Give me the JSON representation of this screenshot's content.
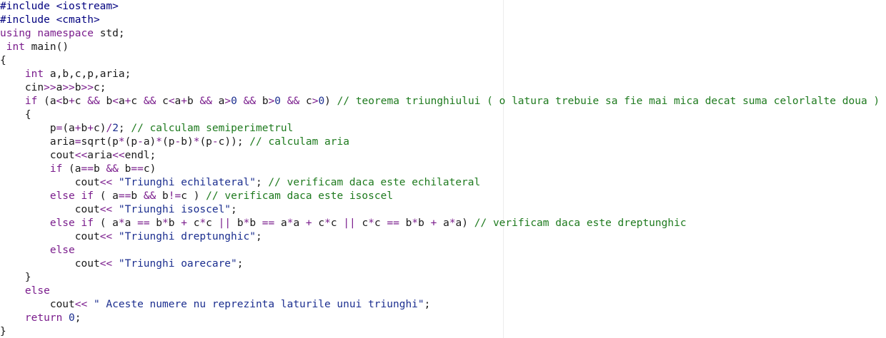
{
  "editor": {
    "lines": [
      {
        "tokens": [
          {
            "t": "#include ",
            "k": "dir"
          },
          {
            "t": "<iostream>",
            "k": "dir"
          }
        ]
      },
      {
        "tokens": [
          {
            "t": "#include ",
            "k": "dir"
          },
          {
            "t": "<cmath>",
            "k": "dir"
          }
        ]
      },
      {
        "tokens": [
          {
            "t": "using",
            "k": "kw"
          },
          {
            "t": " ",
            "k": "text"
          },
          {
            "t": "namespace",
            "k": "kw"
          },
          {
            "t": " std;",
            "k": "text"
          }
        ]
      },
      {
        "tokens": [
          {
            "t": " ",
            "k": "text"
          },
          {
            "t": "int",
            "k": "kw"
          },
          {
            "t": " main()",
            "k": "text"
          }
        ]
      },
      {
        "tokens": [
          {
            "t": "{",
            "k": "text"
          }
        ]
      },
      {
        "tokens": [
          {
            "t": "    ",
            "k": "text"
          },
          {
            "t": "int",
            "k": "kw"
          },
          {
            "t": " a,b,c,p,aria;",
            "k": "text"
          }
        ]
      },
      {
        "tokens": [
          {
            "t": "    cin",
            "k": "text"
          },
          {
            "t": ">>",
            "k": "op"
          },
          {
            "t": "a",
            "k": "text"
          },
          {
            "t": ">>",
            "k": "op"
          },
          {
            "t": "b",
            "k": "text"
          },
          {
            "t": ">>",
            "k": "op"
          },
          {
            "t": "c;",
            "k": "text"
          }
        ]
      },
      {
        "tokens": [
          {
            "t": "    ",
            "k": "text"
          },
          {
            "t": "if",
            "k": "kw"
          },
          {
            "t": " (a",
            "k": "text"
          },
          {
            "t": "<",
            "k": "op"
          },
          {
            "t": "b",
            "k": "text"
          },
          {
            "t": "+",
            "k": "op"
          },
          {
            "t": "c ",
            "k": "text"
          },
          {
            "t": "&&",
            "k": "op"
          },
          {
            "t": " b",
            "k": "text"
          },
          {
            "t": "<",
            "k": "op"
          },
          {
            "t": "a",
            "k": "text"
          },
          {
            "t": "+",
            "k": "op"
          },
          {
            "t": "c ",
            "k": "text"
          },
          {
            "t": "&&",
            "k": "op"
          },
          {
            "t": " c",
            "k": "text"
          },
          {
            "t": "<",
            "k": "op"
          },
          {
            "t": "a",
            "k": "text"
          },
          {
            "t": "+",
            "k": "op"
          },
          {
            "t": "b ",
            "k": "text"
          },
          {
            "t": "&&",
            "k": "op"
          },
          {
            "t": " a",
            "k": "text"
          },
          {
            "t": ">",
            "k": "op"
          },
          {
            "t": "0",
            "k": "num"
          },
          {
            "t": " ",
            "k": "text"
          },
          {
            "t": "&&",
            "k": "op"
          },
          {
            "t": " b",
            "k": "text"
          },
          {
            "t": ">",
            "k": "op"
          },
          {
            "t": "0",
            "k": "num"
          },
          {
            "t": " ",
            "k": "text"
          },
          {
            "t": "&&",
            "k": "op"
          },
          {
            "t": " c",
            "k": "text"
          },
          {
            "t": ">",
            "k": "op"
          },
          {
            "t": "0",
            "k": "num"
          },
          {
            "t": ") ",
            "k": "text"
          },
          {
            "t": "// teorema triunghiului ( o latura trebuie sa fie mai mica decat suma celorlalte doua )",
            "k": "cm"
          }
        ]
      },
      {
        "tokens": [
          {
            "t": "    {",
            "k": "text"
          }
        ]
      },
      {
        "tokens": [
          {
            "t": "        p",
            "k": "text"
          },
          {
            "t": "=",
            "k": "op"
          },
          {
            "t": "(a",
            "k": "text"
          },
          {
            "t": "+",
            "k": "op"
          },
          {
            "t": "b",
            "k": "text"
          },
          {
            "t": "+",
            "k": "op"
          },
          {
            "t": "c)",
            "k": "text"
          },
          {
            "t": "/",
            "k": "op"
          },
          {
            "t": "2",
            "k": "num"
          },
          {
            "t": "; ",
            "k": "text"
          },
          {
            "t": "// calculam semiperimetrul",
            "k": "cm"
          }
        ]
      },
      {
        "tokens": [
          {
            "t": "        aria",
            "k": "text"
          },
          {
            "t": "=",
            "k": "op"
          },
          {
            "t": "sqrt(p",
            "k": "text"
          },
          {
            "t": "*",
            "k": "op"
          },
          {
            "t": "(p",
            "k": "text"
          },
          {
            "t": "-",
            "k": "op"
          },
          {
            "t": "a)",
            "k": "text"
          },
          {
            "t": "*",
            "k": "op"
          },
          {
            "t": "(p",
            "k": "text"
          },
          {
            "t": "-",
            "k": "op"
          },
          {
            "t": "b)",
            "k": "text"
          },
          {
            "t": "*",
            "k": "op"
          },
          {
            "t": "(p",
            "k": "text"
          },
          {
            "t": "-",
            "k": "op"
          },
          {
            "t": "c)); ",
            "k": "text"
          },
          {
            "t": "// calculam aria",
            "k": "cm"
          }
        ]
      },
      {
        "tokens": [
          {
            "t": "        cout",
            "k": "text"
          },
          {
            "t": "<<",
            "k": "op"
          },
          {
            "t": "aria",
            "k": "text"
          },
          {
            "t": "<<",
            "k": "op"
          },
          {
            "t": "endl;",
            "k": "text"
          }
        ]
      },
      {
        "tokens": [
          {
            "t": "        ",
            "k": "text"
          },
          {
            "t": "if",
            "k": "kw"
          },
          {
            "t": " (a",
            "k": "text"
          },
          {
            "t": "==",
            "k": "op"
          },
          {
            "t": "b ",
            "k": "text"
          },
          {
            "t": "&&",
            "k": "op"
          },
          {
            "t": " b",
            "k": "text"
          },
          {
            "t": "==",
            "k": "op"
          },
          {
            "t": "c)",
            "k": "text"
          }
        ]
      },
      {
        "tokens": [
          {
            "t": "            cout",
            "k": "text"
          },
          {
            "t": "<<",
            "k": "op"
          },
          {
            "t": " ",
            "k": "text"
          },
          {
            "t": "\"Triunghi echilateral\"",
            "k": "str"
          },
          {
            "t": "; ",
            "k": "text"
          },
          {
            "t": "// verificam daca este echilateral",
            "k": "cm"
          }
        ]
      },
      {
        "tokens": [
          {
            "t": "        ",
            "k": "text"
          },
          {
            "t": "else",
            "k": "kw"
          },
          {
            "t": " ",
            "k": "text"
          },
          {
            "t": "if",
            "k": "kw"
          },
          {
            "t": " ( a",
            "k": "text"
          },
          {
            "t": "==",
            "k": "op"
          },
          {
            "t": "b ",
            "k": "text"
          },
          {
            "t": "&&",
            "k": "op"
          },
          {
            "t": " b",
            "k": "text"
          },
          {
            "t": "!=",
            "k": "op"
          },
          {
            "t": "c ) ",
            "k": "text"
          },
          {
            "t": "// verificam daca este isoscel",
            "k": "cm"
          }
        ]
      },
      {
        "tokens": [
          {
            "t": "            cout",
            "k": "text"
          },
          {
            "t": "<<",
            "k": "op"
          },
          {
            "t": " ",
            "k": "text"
          },
          {
            "t": "\"Triunghi isoscel\"",
            "k": "str"
          },
          {
            "t": ";",
            "k": "text"
          }
        ]
      },
      {
        "tokens": [
          {
            "t": "        ",
            "k": "text"
          },
          {
            "t": "else",
            "k": "kw"
          },
          {
            "t": " ",
            "k": "text"
          },
          {
            "t": "if",
            "k": "kw"
          },
          {
            "t": " ( a",
            "k": "text"
          },
          {
            "t": "*",
            "k": "op"
          },
          {
            "t": "a ",
            "k": "text"
          },
          {
            "t": "==",
            "k": "op"
          },
          {
            "t": " b",
            "k": "text"
          },
          {
            "t": "*",
            "k": "op"
          },
          {
            "t": "b ",
            "k": "text"
          },
          {
            "t": "+",
            "k": "op"
          },
          {
            "t": " c",
            "k": "text"
          },
          {
            "t": "*",
            "k": "op"
          },
          {
            "t": "c ",
            "k": "text"
          },
          {
            "t": "||",
            "k": "op"
          },
          {
            "t": " b",
            "k": "text"
          },
          {
            "t": "*",
            "k": "op"
          },
          {
            "t": "b ",
            "k": "text"
          },
          {
            "t": "==",
            "k": "op"
          },
          {
            "t": " a",
            "k": "text"
          },
          {
            "t": "*",
            "k": "op"
          },
          {
            "t": "a ",
            "k": "text"
          },
          {
            "t": "+",
            "k": "op"
          },
          {
            "t": " c",
            "k": "text"
          },
          {
            "t": "*",
            "k": "op"
          },
          {
            "t": "c ",
            "k": "text"
          },
          {
            "t": "||",
            "k": "op"
          },
          {
            "t": " c",
            "k": "text"
          },
          {
            "t": "*",
            "k": "op"
          },
          {
            "t": "c ",
            "k": "text"
          },
          {
            "t": "==",
            "k": "op"
          },
          {
            "t": " b",
            "k": "text"
          },
          {
            "t": "*",
            "k": "op"
          },
          {
            "t": "b ",
            "k": "text"
          },
          {
            "t": "+",
            "k": "op"
          },
          {
            "t": " a",
            "k": "text"
          },
          {
            "t": "*",
            "k": "op"
          },
          {
            "t": "a) ",
            "k": "text"
          },
          {
            "t": "// verificam daca este dreptunghic",
            "k": "cm"
          }
        ]
      },
      {
        "tokens": [
          {
            "t": "            cout",
            "k": "text"
          },
          {
            "t": "<<",
            "k": "op"
          },
          {
            "t": " ",
            "k": "text"
          },
          {
            "t": "\"Triunghi dreptunghic\"",
            "k": "str"
          },
          {
            "t": ";",
            "k": "text"
          }
        ]
      },
      {
        "tokens": [
          {
            "t": "        ",
            "k": "text"
          },
          {
            "t": "else",
            "k": "kw"
          }
        ]
      },
      {
        "tokens": [
          {
            "t": "            cout",
            "k": "text"
          },
          {
            "t": "<<",
            "k": "op"
          },
          {
            "t": " ",
            "k": "text"
          },
          {
            "t": "\"Triunghi oarecare\"",
            "k": "str"
          },
          {
            "t": ";",
            "k": "text"
          }
        ]
      },
      {
        "tokens": [
          {
            "t": "    }",
            "k": "text"
          }
        ]
      },
      {
        "tokens": [
          {
            "t": "    ",
            "k": "text"
          },
          {
            "t": "else",
            "k": "kw"
          }
        ]
      },
      {
        "tokens": [
          {
            "t": "        cout",
            "k": "text"
          },
          {
            "t": "<<",
            "k": "op"
          },
          {
            "t": " ",
            "k": "text"
          },
          {
            "t": "\" Aceste numere nu reprezinta laturile unui triunghi\"",
            "k": "str"
          },
          {
            "t": ";",
            "k": "text"
          }
        ]
      },
      {
        "tokens": [
          {
            "t": "    ",
            "k": "text"
          },
          {
            "t": "return",
            "k": "kw"
          },
          {
            "t": " ",
            "k": "text"
          },
          {
            "t": "0",
            "k": "num"
          },
          {
            "t": ";",
            "k": "text"
          }
        ]
      },
      {
        "tokens": [
          {
            "t": "}",
            "k": "text"
          }
        ]
      }
    ]
  }
}
